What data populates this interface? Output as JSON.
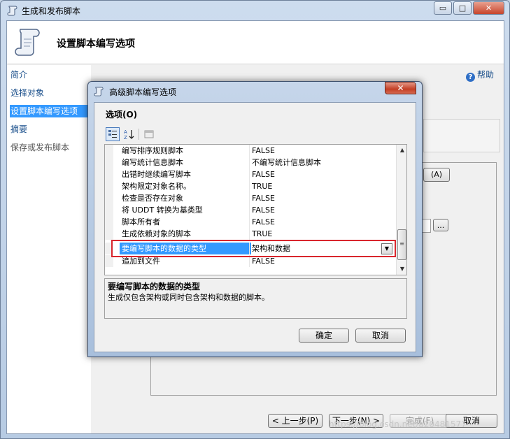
{
  "main_window": {
    "title": "生成和发布脚本",
    "caption_buttons": {
      "minimize": "▭",
      "maximize": "□",
      "close": "✕"
    },
    "header_title": "设置脚本编写选项",
    "help_label": "帮助",
    "nav": [
      "简介",
      "选择对象",
      "设置脚本编写选项",
      "摘要",
      "保存或发布脚本"
    ],
    "side_button": "(A)",
    "ellipsis_button": "...",
    "wizard_buttons": {
      "back": "< 上一步(P)",
      "next": "下一步(N) >",
      "finish": "完成(F)",
      "cancel": "取消"
    }
  },
  "dialog": {
    "title": "高级脚本编写选项",
    "close": "✕",
    "options_label": "选项(O)",
    "rows": [
      {
        "name": "编写排序规则脚本",
        "value": "FALSE"
      },
      {
        "name": "编写统计信息脚本",
        "value": "不编写统计信息脚本"
      },
      {
        "name": "出错时继续编写脚本",
        "value": "FALSE"
      },
      {
        "name": "架构限定对象名称。",
        "value": "TRUE"
      },
      {
        "name": "检查是否存在对象",
        "value": "FALSE"
      },
      {
        "name": "将 UDDT 转换为基类型",
        "value": "FALSE"
      },
      {
        "name": "脚本所有者",
        "value": "FALSE"
      },
      {
        "name": "生成依赖对象的脚本",
        "value": "TRUE"
      },
      {
        "name": "要编写脚本的数据的类型",
        "value": "架构和数据"
      },
      {
        "name": "追加到文件",
        "value": "FALSE"
      }
    ],
    "description_title": "要编写脚本的数据的类型",
    "description_text": "生成仅包含架构或同时包含架构和数据的脚本。",
    "ok_label": "确定",
    "cancel_label": "取消",
    "scroll_up": "▲",
    "scroll_down": "▼",
    "scroll_grip": "≡",
    "combo_arrow": "▼"
  },
  "watermark": "https://blog.csdn.net/a20481577",
  "colors": {
    "selection": "#3399ff",
    "highlight_box": "#d9262d",
    "link": "#1a4f8b"
  }
}
